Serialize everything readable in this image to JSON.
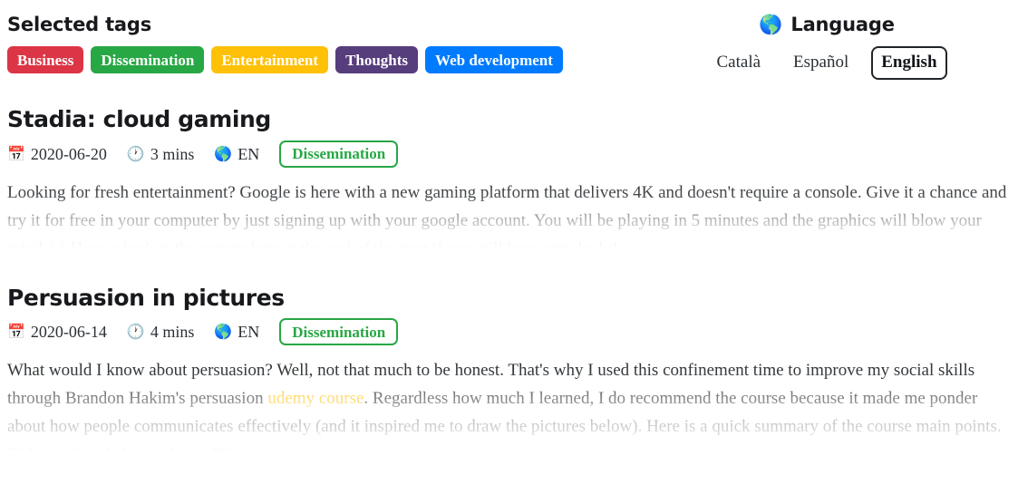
{
  "tags_panel": {
    "heading": "Selected tags",
    "tags": [
      {
        "label": "Business",
        "color": "#dc3545"
      },
      {
        "label": "Dissemination",
        "color": "#28a745"
      },
      {
        "label": "Entertainment",
        "color": "#ffc107"
      },
      {
        "label": "Thoughts",
        "color": "#563d7c"
      },
      {
        "label": "Web development",
        "color": "#007bff"
      }
    ]
  },
  "language_panel": {
    "icon": "globe-icon",
    "icon_glyph": "🌎",
    "heading": "Language",
    "options": [
      {
        "label": "Català",
        "active": false
      },
      {
        "label": "Español",
        "active": false
      },
      {
        "label": "English",
        "active": true
      }
    ]
  },
  "posts": [
    {
      "title": "Stadia: cloud gaming",
      "meta": {
        "date_icon": "calendar-icon",
        "date_glyph": "📅",
        "date": "2020-06-20",
        "time_icon": "clock-icon",
        "time_glyph": "🕐",
        "read_time": "3 mins",
        "lang_icon": "globe-icon",
        "lang_glyph": "🌎",
        "lang": "EN",
        "tag": "Dissemination",
        "tag_color": "#28a745"
      },
      "excerpt_part_1": "Looking for fresh entertainment? Google is here with a new gaming platform that delivers 4K and doesn't require a console. Give it a chance and try it for free in your computer by just signing up with your google account. You will be playing in 5 minutes and the graphics will blow your mind ",
      "excerpt_emoji": "🤯",
      "excerpt_part_2": " Have a look at the screenshots at the end of the post if you still have any doubt!"
    },
    {
      "title": "Persuasion in pictures",
      "meta": {
        "date_icon": "calendar-icon",
        "date_glyph": "📅",
        "date": "2020-06-14",
        "time_icon": "clock-icon",
        "time_glyph": "🕐",
        "read_time": "4 mins",
        "lang_icon": "globe-icon",
        "lang_glyph": "🌎",
        "lang": "EN",
        "tag": "Dissemination",
        "tag_color": "#28a745"
      },
      "excerpt_part_1": "What would I know about persuasion? Well, not that much to be honest. That's why I used this confinement time to improve my social skills through Brandon Hakim's persuasion ",
      "excerpt_link": "udemy course",
      "excerpt_part_2": ". Regardless how much I learned, I do recommend the course because it made me ponder about how people communicates effectively (and it inspired me to draw the pictures below). Here is a quick summary of the course main points. Did you already know them all?"
    }
  ]
}
